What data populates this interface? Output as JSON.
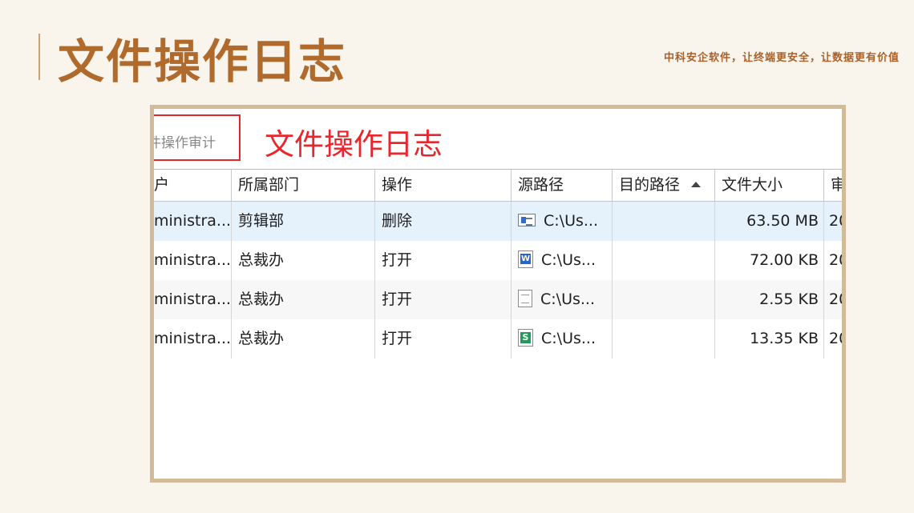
{
  "slide": {
    "title": "文件操作日志",
    "slogan": "中科安企软件，让终端更安全，让数据更有价值"
  },
  "screenshot": {
    "tab_label": "件操作审计",
    "annotation": "文件操作日志",
    "columns": [
      {
        "label": "户"
      },
      {
        "label": "所属部门"
      },
      {
        "label": "操作"
      },
      {
        "label": "源路径"
      },
      {
        "label": "目的路径",
        "sort": "ascending"
      },
      {
        "label": "文件大小"
      },
      {
        "label": "审"
      }
    ],
    "rows": [
      {
        "user": "ministra...",
        "dept": "剪辑部",
        "op": "删除",
        "icon": "exe-file-icon",
        "src": "C:\\Us...",
        "dest": "",
        "size": "63.50 MB",
        "time": "20",
        "selected": true
      },
      {
        "user": "ministra...",
        "dept": "总裁办",
        "op": "打开",
        "icon": "word-file-icon",
        "src": "C:\\Us...",
        "dest": "",
        "size": "72.00 KB",
        "time": "20",
        "selected": false
      },
      {
        "user": "ministra...",
        "dept": "总裁办",
        "op": "打开",
        "icon": "text-file-icon",
        "src": "C:\\Us...",
        "dest": "",
        "size": "2.55 KB",
        "time": "20",
        "selected": false
      },
      {
        "user": "ministra...",
        "dept": "总裁办",
        "op": "打开",
        "icon": "spreadsheet-file-icon",
        "src": "C:\\Us...",
        "dest": "",
        "size": "13.35 KB",
        "time": "20",
        "selected": false
      }
    ],
    "colors": {
      "annotation": "#e8262b",
      "selection": "#e5f1fb",
      "title": "#b06a2c"
    }
  }
}
